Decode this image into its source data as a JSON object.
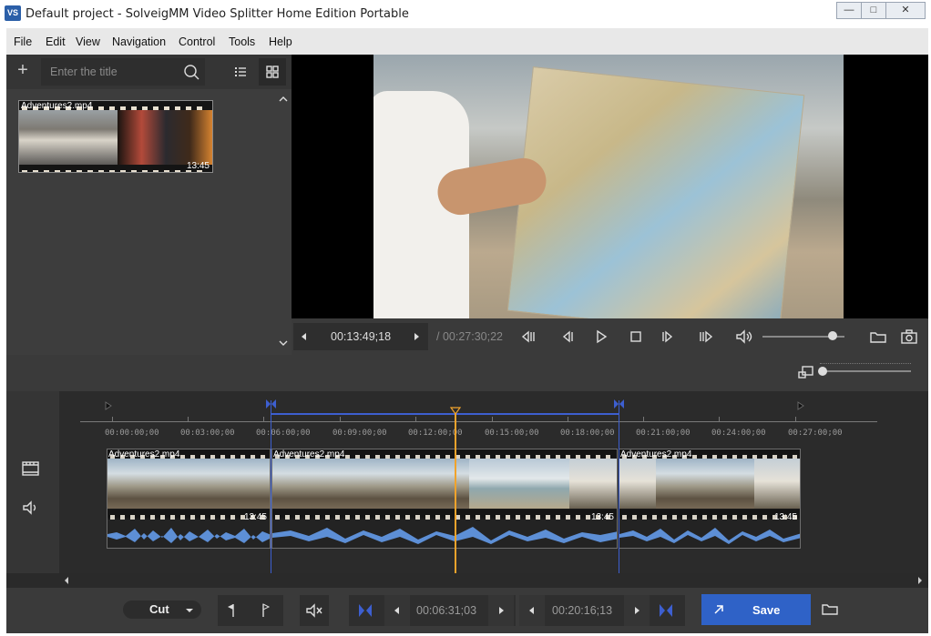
{
  "window": {
    "title": "Default project - SolveigMM Video Splitter Home Edition Portable",
    "app_icon_text": "VS"
  },
  "menu": [
    "File",
    "Edit",
    "View",
    "Navigation",
    "Control",
    "Tools",
    "Help"
  ],
  "library": {
    "title_placeholder": "Enter the title",
    "items": [
      {
        "filename": "Adventures2.mp4",
        "duration": "13:45"
      }
    ]
  },
  "player": {
    "current_time": "00:13:49;18",
    "total_time": "/ 00:27:30;22",
    "volume": 0.85
  },
  "timeline": {
    "ruler_labels": [
      "00:00:00;00",
      "00:03:00;00",
      "00:06:00;00",
      "00:09:00;00",
      "00:12:00;00",
      "00:15:00;00",
      "00:18:00;00",
      "00:21:00;00",
      "00:24:00;00",
      "00:27:00;00"
    ],
    "clips": [
      {
        "name": "Adventures2.mp4",
        "duration": "13:45"
      },
      {
        "name": "Adventures2.mp4",
        "duration": "13:45"
      },
      {
        "name": "Adventures2.mp4",
        "duration": "13:45"
      }
    ]
  },
  "bottom": {
    "mode": "Cut",
    "start_time": "00:06:31;03",
    "end_time": "00:20:16;13",
    "save_label": "Save"
  },
  "colors": {
    "accent": "#2f62c7",
    "playhead": "#f0a32c",
    "selection": "#3d5fd0",
    "waveform": "#5d8fd6"
  }
}
